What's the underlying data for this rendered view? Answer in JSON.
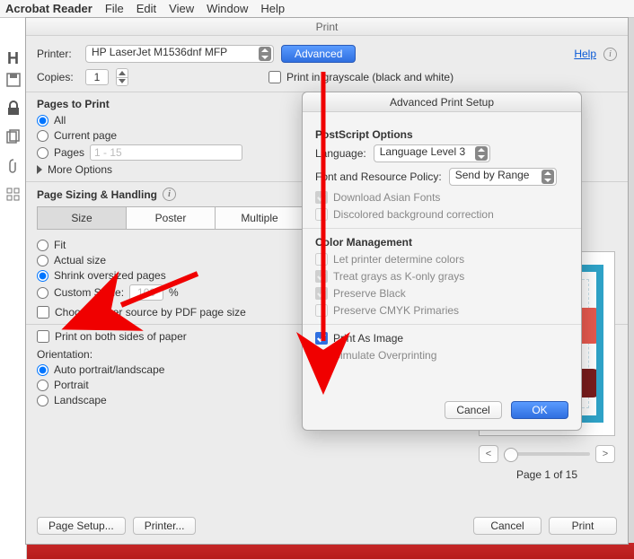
{
  "menubar": {
    "app": "Acrobat Reader",
    "items": [
      "File",
      "Edit",
      "View",
      "Window",
      "Help"
    ]
  },
  "print": {
    "title": "Print",
    "printer_label": "Printer:",
    "printer_value": "HP LaserJet M1536dnf MFP",
    "advanced_btn": "Advanced",
    "help": "Help",
    "copies_label": "Copies:",
    "copies_value": "1",
    "grayscale": "Print in grayscale (black and white)",
    "pages_title": "Pages to Print",
    "all": "All",
    "current": "Current page",
    "pages": "Pages",
    "pages_range": "1 - 15",
    "more": "More Options",
    "sizing_title": "Page Sizing & Handling",
    "tabs": [
      "Size",
      "Poster",
      "Multiple"
    ],
    "fit": "Fit",
    "actual": "Actual size",
    "shrink": "Shrink oversized pages",
    "custom": "Custom Scale:",
    "custom_val": "100",
    "pct": "%",
    "choose_src": "Choose paper source by PDF page size",
    "both_sides": "Print on both sides of paper",
    "orient_title": "Orientation:",
    "orient_auto": "Auto portrait/landscape",
    "orient_portrait": "Portrait",
    "orient_landscape": "Landscape",
    "page_setup": "Page Setup...",
    "printer_btn": "Printer...",
    "cancel": "Cancel",
    "print_btn": "Print",
    "page_of": "Page 1 of 15"
  },
  "adv": {
    "title": "Advanced Print Setup",
    "ps_title": "PostScript Options",
    "lang_label": "Language:",
    "lang_value": "Language Level 3",
    "frp_label": "Font and Resource Policy:",
    "frp_value": "Send by Range",
    "dl_asian": "Download Asian Fonts",
    "discolor": "Discolored background correction",
    "cm_title": "Color Management",
    "let_printer": "Let printer determine colors",
    "treat_grays": "Treat grays as K-only grays",
    "preserve_black": "Preserve Black",
    "preserve_cmyk": "Preserve CMYK Primaries",
    "print_image": "Print As Image",
    "simulate": "Simulate Overprinting",
    "cancel": "Cancel",
    "ok": "OK"
  }
}
